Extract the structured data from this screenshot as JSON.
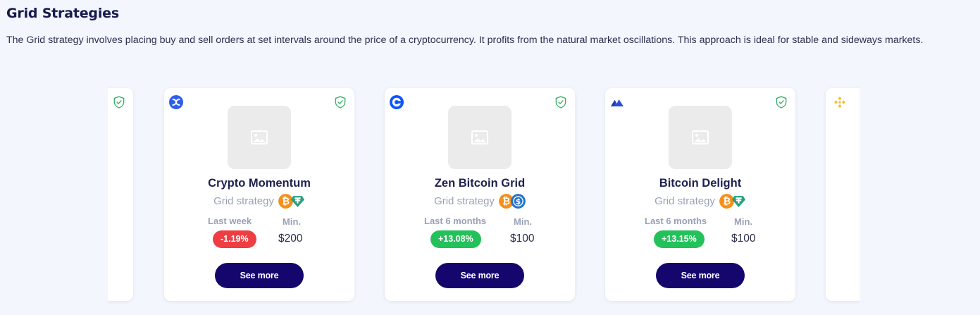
{
  "section": {
    "title": "Grid Strategies",
    "description": "The Grid strategy involves placing buy and sell orders at set intervals around the price of a cryptocurrency. It profits from the natural market oscillations. This approach is ideal for stable and sideways markets."
  },
  "cards": [
    {
      "exchange_icon": "crossed-arrows-exchange-icon",
      "name": "Crypto Momentum",
      "type": "Grid strategy",
      "coins": [
        "bitcoin-icon",
        "tether-icon"
      ],
      "period_label": "Last week",
      "return": "-1.19%",
      "return_sign": "negative",
      "min_label": "Min.",
      "min_value": "$200",
      "button": "See more"
    },
    {
      "exchange_icon": "coinbase-icon",
      "name": "Zen Bitcoin Grid",
      "type": "Grid strategy",
      "coins": [
        "bitcoin-icon",
        "usdc-icon"
      ],
      "period_label": "Last 6 months",
      "return": "+13.08%",
      "return_sign": "positive",
      "min_label": "Min.",
      "min_value": "$100",
      "button": "See more"
    },
    {
      "exchange_icon": "kraken-mountain-icon",
      "name": "Bitcoin Delight",
      "type": "Grid strategy",
      "coins": [
        "bitcoin-icon",
        "tether-icon"
      ],
      "period_label": "Last 6 months",
      "return": "+13.15%",
      "return_sign": "positive",
      "min_label": "Min.",
      "min_value": "$100",
      "button": "See more"
    }
  ],
  "peek_cards": {
    "left_icon": "verified-shield-icon",
    "right_icon": "binance-icon"
  },
  "colors": {
    "accent_button": "#15066e",
    "positive": "#23c15a",
    "negative": "#ee3e44",
    "shield": "#3bb26a"
  }
}
